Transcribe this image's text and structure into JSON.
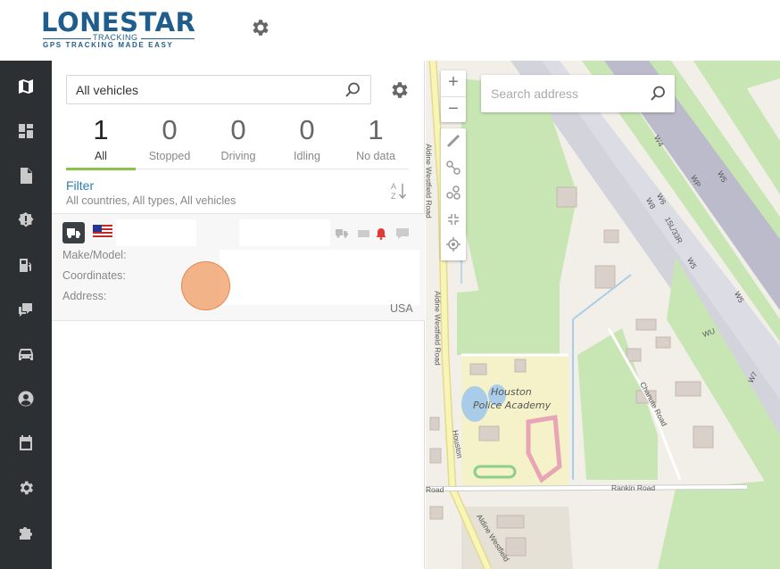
{
  "header": {
    "logo_main": "LONESTAR",
    "logo_sub": "TRACKING",
    "logo_tagline": "GPS TRACKING MADE EASY",
    "settings_icon": "gear-icon"
  },
  "sidebar": {
    "items": [
      {
        "name": "map",
        "icon": "map-icon",
        "active": true
      },
      {
        "name": "dashboard",
        "icon": "dashboard-icon"
      },
      {
        "name": "reports",
        "icon": "document-icon"
      },
      {
        "name": "alerts",
        "icon": "alert-badge-icon"
      },
      {
        "name": "fuel",
        "icon": "fuel-icon"
      },
      {
        "name": "messages",
        "icon": "chat-icon"
      },
      {
        "name": "vehicles",
        "icon": "car-icon"
      },
      {
        "name": "users",
        "icon": "user-icon"
      },
      {
        "name": "calendar",
        "icon": "calendar-icon"
      },
      {
        "name": "settings",
        "icon": "gear-icon"
      },
      {
        "name": "integrations",
        "icon": "puzzle-icon"
      }
    ]
  },
  "panel": {
    "search": {
      "value": "All vehicles",
      "icon": "search-icon"
    },
    "settings_icon": "gear-icon",
    "counts": [
      {
        "num": "1",
        "label": "All",
        "active": true
      },
      {
        "num": "0",
        "label": "Stopped"
      },
      {
        "num": "0",
        "label": "Driving"
      },
      {
        "num": "0",
        "label": "Idling"
      },
      {
        "num": "1",
        "label": "No data"
      }
    ],
    "filter": {
      "title": "Filter",
      "subtitle": "All countries, All types, All vehicles",
      "sort_icon": "sort-az-icon"
    },
    "vehicle": {
      "fields": [
        "Make/Model:",
        "Coordinates:",
        "Address:"
      ],
      "country": "USA",
      "status_icons": [
        "truck-icon",
        "battery-icon",
        "bell-icon",
        "message-icon"
      ]
    }
  },
  "map": {
    "search_placeholder": "Search address",
    "zoom_in": "+",
    "zoom_out": "−",
    "labels": {
      "academy_line1": "Houston",
      "academy_line2": "Police Academy",
      "road1": "Aldine Westfield Road",
      "road2": "Aldine Westfield Road",
      "road3": "Rankin Road",
      "road4": "Road",
      "road5": "Houston",
      "road6": "Chanute Road",
      "road7": "Aldine Westfield",
      "rwy1": "W4",
      "rwy2": "WP",
      "rwy3": "W5",
      "rwy4": "W6",
      "rwy5": "W8",
      "rwy6": "15L/33R",
      "rwy7": "W5",
      "rwy8": "W5",
      "rwy9": "WU",
      "rwy10": "W7"
    },
    "colors": {
      "land": "#f2efe9",
      "grass": "#c8e6b4",
      "runway": "#bbbbcc",
      "road": "#f7f6b7"
    }
  }
}
